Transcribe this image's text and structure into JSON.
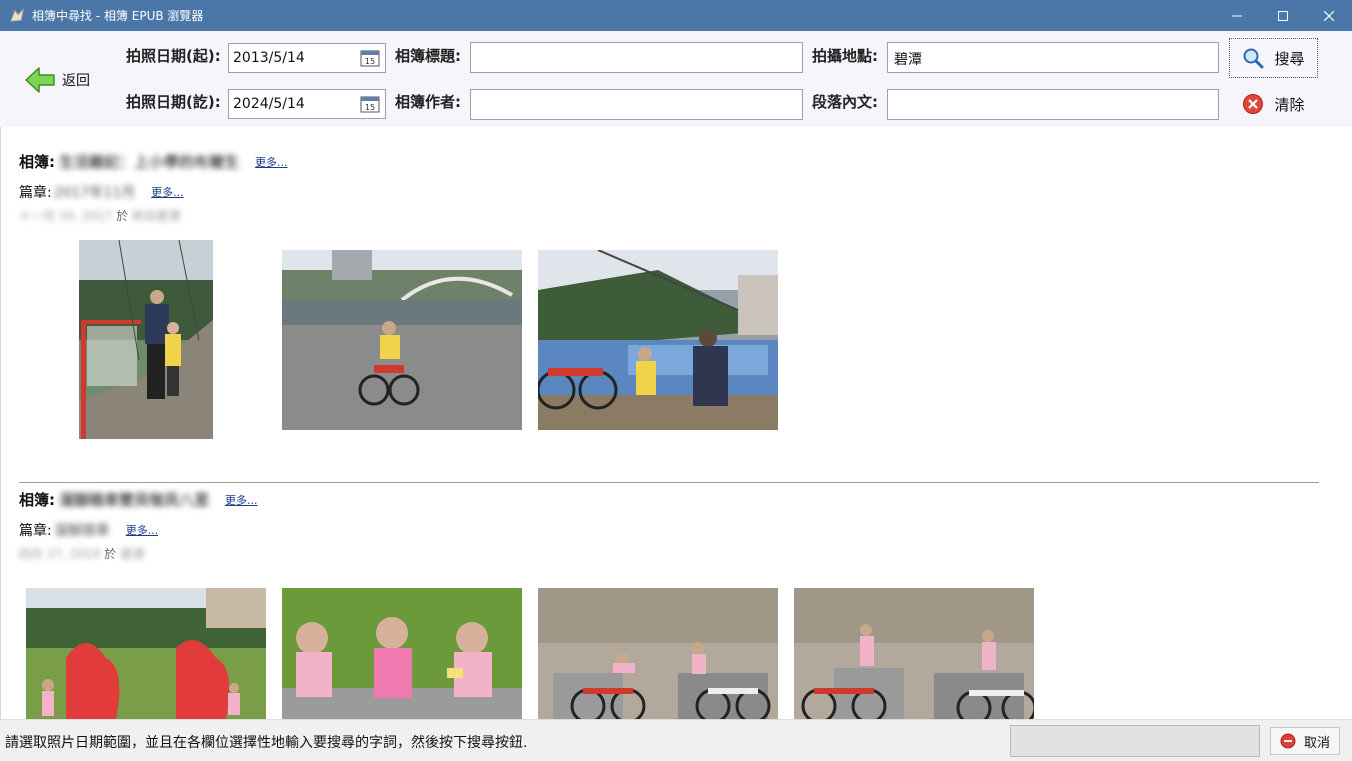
{
  "window": {
    "title": "相簿中尋找 - 相簿 EPUB 瀏覽器"
  },
  "search": {
    "back_label": "返回",
    "date_start_label": "拍照日期(起):",
    "date_start_value": "2013/5/14",
    "date_end_label": "拍照日期(訖):",
    "date_end_value": "2024/5/14",
    "album_title_label": "相簿標題:",
    "album_title_value": "",
    "album_author_label": "相簿作者:",
    "album_author_value": "",
    "location_label": "拍攝地點:",
    "location_value": "碧潭",
    "paragraph_label": "段落內文:",
    "paragraph_value": "",
    "search_button": "搜尋",
    "clear_button": "清除"
  },
  "results": [
    {
      "album_prefix": "相簿:",
      "album_name": "生活雜記：上小學的布爾生",
      "more": "更多...",
      "chapter_prefix": "篇章:",
      "chapter_name": "2017年11月",
      "chapter_more": "更多...",
      "date_text": "十一月 10, 2017",
      "at_word": "於",
      "place_text": "新店碧潭",
      "photos": [
        "bridge-grandma-child",
        "child-bike-riverside",
        "bike-boats-grandma"
      ]
    },
    {
      "album_prefix": "相簿:",
      "album_name": "溜腳踏車雙貝咖貝八里",
      "more": "更多...",
      "chapter_prefix": "篇章:",
      "chapter_name": "溜腳踏車",
      "chapter_more": "更多...",
      "date_text": "四月 27, 2019",
      "at_word": "於",
      "place_text": "碧潭",
      "photos": [
        "red-swan-park",
        "kids-on-grass",
        "kids-with-bikes-wall-1",
        "kids-with-bikes-wall-2"
      ]
    }
  ],
  "status": {
    "message": "請選取照片日期範圍，並且在各欄位選擇性地輸入要搜尋的字詞，然後按下搜尋按鈕.",
    "cancel_button": "取消"
  },
  "colors": {
    "titlebar": "#4a76a8",
    "panel": "#f5f5fb",
    "link": "#1a3a8a"
  }
}
